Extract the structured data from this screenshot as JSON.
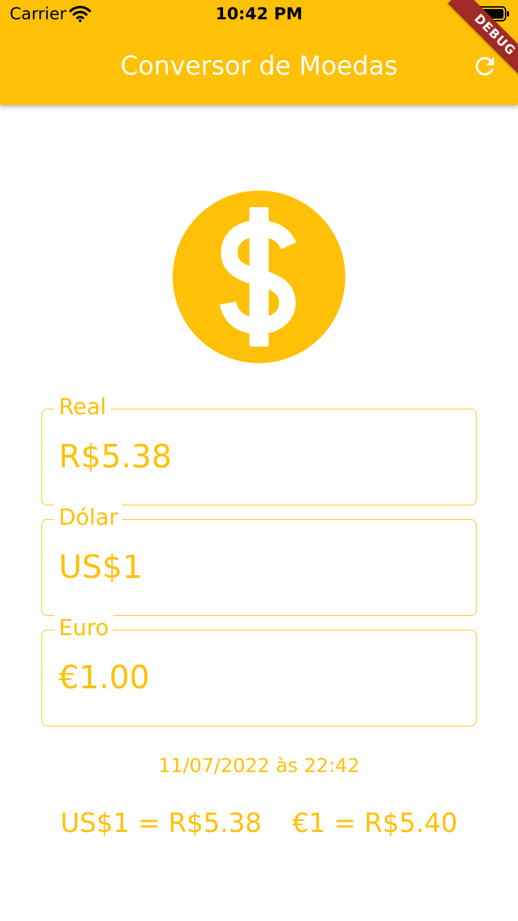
{
  "status_bar": {
    "carrier": "Carrier",
    "time": "10:42 PM"
  },
  "app_bar": {
    "title": "Conversor de Moedas",
    "debug_label": "DEBUG"
  },
  "colors": {
    "accent": "#FFC107",
    "on_accent": "#FFFFFF",
    "background": "#FFFFFF",
    "debug_banner": "#A02A25"
  },
  "icons": {
    "hero": "dollar-icon",
    "action": "refresh-icon"
  },
  "fields": [
    {
      "label": "Real",
      "value": "R$5.38"
    },
    {
      "label": "Dólar",
      "value": "US$1"
    },
    {
      "label": "Euro",
      "value": "€1.00"
    }
  ],
  "updated_at": "11/07/2022 às 22:42",
  "rates": {
    "usd": "US$1 = R$5.38",
    "eur": "€1 = R$5.40"
  }
}
